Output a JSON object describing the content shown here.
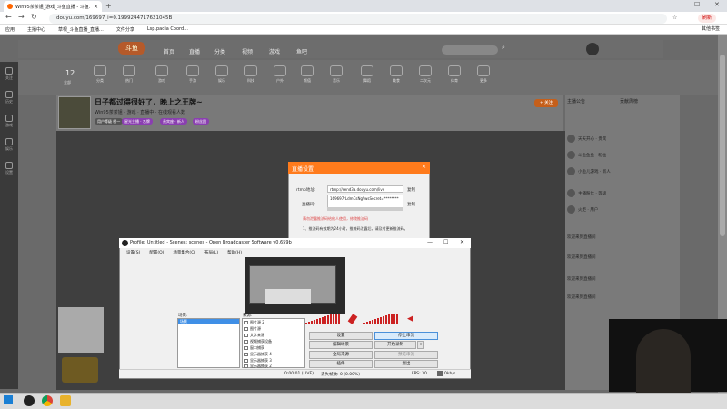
{
  "browser": {
    "tab_title": "Win95茶茶姐_游戏_斗鱼直播 - 斗鱼…",
    "tab_close": "×",
    "new_tab": "+",
    "address": "douyu.com/169697_i=0.1999244717621045B",
    "bookmarks": [
      "应用",
      "主播中心",
      "草根_斗鱼直播_直播...",
      "文件分享",
      "Lsp.padia Coord..."
    ],
    "bookmarks_right": "其他书签",
    "profile_btn": "刷新"
  },
  "site": {
    "logo": "斗鱼",
    "nav": [
      "首页",
      "直播",
      "分类",
      "视频",
      "游戏",
      "鱼吧"
    ],
    "categories": [
      "12",
      "全部",
      "分类",
      "热门",
      "游戏",
      "手游",
      "娱乐",
      "科技",
      "户外",
      "颜值",
      "音乐",
      "舞蹈",
      "美食",
      "二次元",
      "体育",
      "更多"
    ],
    "follow_count": "12",
    "stream_title": "日子都过得很好了，晚上之王牌~",
    "streamer_line": "Win95茶茶姐  · 游戏 · 直播中 · 在线观看人数",
    "tags": [
      "用户等级 榜一",
      "星光主播 · 名牌",
      "贵宾座 · 新人",
      "粉丝团"
    ],
    "follow_button": "+ 关注",
    "right_panel": {
      "header1": "主播公告",
      "header2": "贡献周榜",
      "rows": [
        "天天开心 · 贵宾",
        "斗鱼鱼鱼 · 粉丝",
        "小鱼儿游戏 · 新人",
        "主播粉丝 · 等级",
        "火炬 · 用户",
        "欢迎来到直播间",
        "欢迎来到直播间",
        "欢迎来到直播间",
        "欢迎来到直播间"
      ]
    }
  },
  "rail": [
    "关注",
    "历史",
    "游戏",
    "娱乐",
    "设置"
  ],
  "dialog": {
    "title": "直播设置",
    "close": "×",
    "rtmp_label": "rtmp地址:",
    "rtmp_value": "rtmp://send3a.douyu.com/live",
    "copy": "复制",
    "code_label": "直播码:",
    "code_value": "169697rLdmCsNg?wsSecret=********",
    "warning": "请勿泄露推流码给他人使用，修改推流码",
    "tip": "1、推流码有效期为24小时，推流码泄露后，请及时更新推流码。"
  },
  "obs": {
    "title": "Profile: Untitled - Scenes: scenes - Open Broadcaster Software v0.659b",
    "menu": [
      "设置(S)",
      "配置(O)",
      "场景集合(C)",
      "布局(L)",
      "帮助(H)"
    ],
    "scenes_header": "场景:",
    "sources_header": "来源:",
    "scene_selected": "场景",
    "sources": [
      "图片源 2",
      "图片源",
      "文字来源",
      "视频捕获设备",
      "窗口捕获",
      "显示器捕获 4",
      "显示器捕获 3",
      "显示器捕获 2"
    ],
    "buttons": {
      "settings": "设置",
      "stop_stream": "停止串流",
      "edit_scene": "编辑场景",
      "start_record": "开始录制",
      "global_sources": "全局来源",
      "preview": "预览串流",
      "plugins": "插件",
      "exit": "退出"
    },
    "status": {
      "time": "0:00:01 (LIVE)",
      "dropped": "丢失帧数: 0 (0.00%)",
      "fps": "FPS: 30",
      "bitrate": "0kb/s"
    }
  },
  "window_controls": {
    "min": "—",
    "max": "☐",
    "close": "✕"
  }
}
